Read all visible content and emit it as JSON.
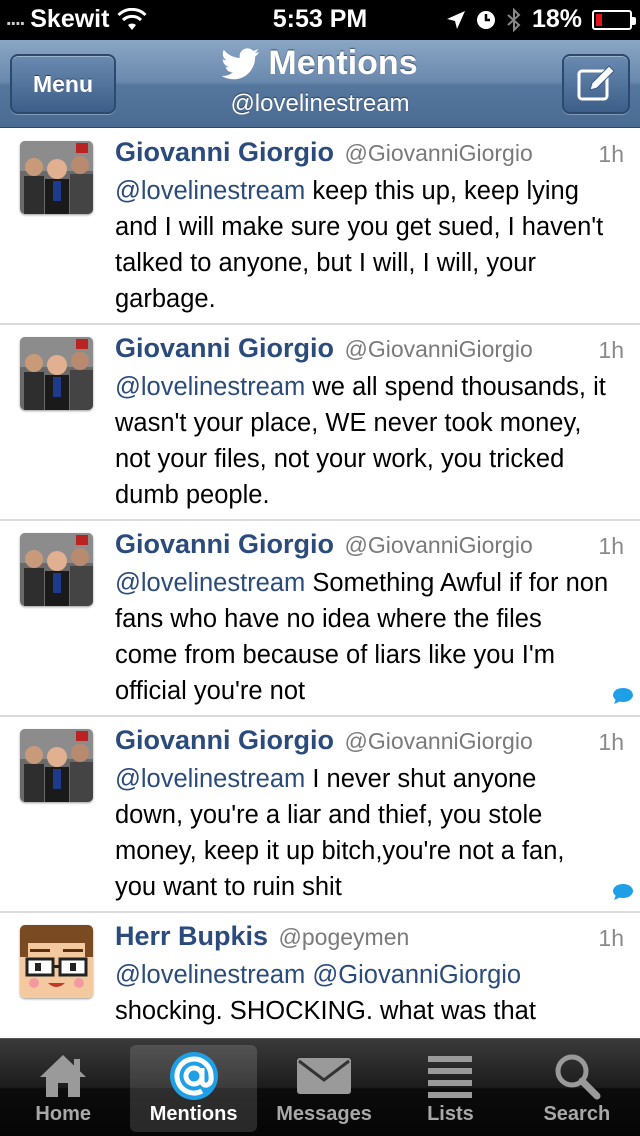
{
  "status_bar": {
    "signal": "....",
    "carrier": "Skewit",
    "time": "5:53 PM",
    "battery": "18%",
    "battery_level": 0.18,
    "battery_color": "#e0141a"
  },
  "nav": {
    "menu_label": "Menu",
    "title": "Mentions",
    "subtitle": "@lovelinestream",
    "compose_icon": "compose-icon",
    "bar_color": "#5e7fa5"
  },
  "tweets": [
    {
      "name": "Giovanni Giorgio",
      "handle": "@GiovanniGiorgio",
      "time": "1h",
      "mentions": "@lovelinestream",
      "text": " keep this up, keep lying and I will make sure you get sued, I haven't talked to anyone, but I will, I will, your garbage.",
      "has_conversation": false
    },
    {
      "name": "Giovanni Giorgio",
      "handle": "@GiovanniGiorgio",
      "time": "1h",
      "mentions": "@lovelinestream",
      "text": " we all spend thousands, it wasn't your place, WE never took money, not your files, not your work, you tricked dumb people.",
      "has_conversation": false
    },
    {
      "name": "Giovanni Giorgio",
      "handle": "@GiovanniGiorgio",
      "time": "1h",
      "mentions": "@lovelinestream",
      "text": " Something Awful if for non fans who have no idea where the files come from because of liars like you I'm official you're not",
      "has_conversation": true
    },
    {
      "name": "Giovanni Giorgio",
      "handle": "@GiovanniGiorgio",
      "time": "1h",
      "mentions": "@lovelinestream",
      "text": " I never shut anyone down, you're a liar and thief, you stole money, keep it up bitch,you're not a fan, you want to ruin shit",
      "has_conversation": true
    },
    {
      "name": "Herr Bupkis",
      "handle": "@pogeymen",
      "time": "1h",
      "mentions": "@lovelinestream @GiovanniGiorgio",
      "text": " shocking. SHOCKING. what was that",
      "has_conversation": false
    }
  ],
  "tabs": [
    {
      "label": "Home",
      "icon": "home-icon",
      "active": false
    },
    {
      "label": "Mentions",
      "icon": "at-icon",
      "active": true
    },
    {
      "label": "Messages",
      "icon": "envelope-icon",
      "active": false
    },
    {
      "label": "Lists",
      "icon": "lists-icon",
      "active": false
    },
    {
      "label": "Search",
      "icon": "search-icon",
      "active": false
    }
  ],
  "colors": {
    "link": "#2a4b7c",
    "accent": "#1fa0e6",
    "divider": "#dcdcdc"
  }
}
